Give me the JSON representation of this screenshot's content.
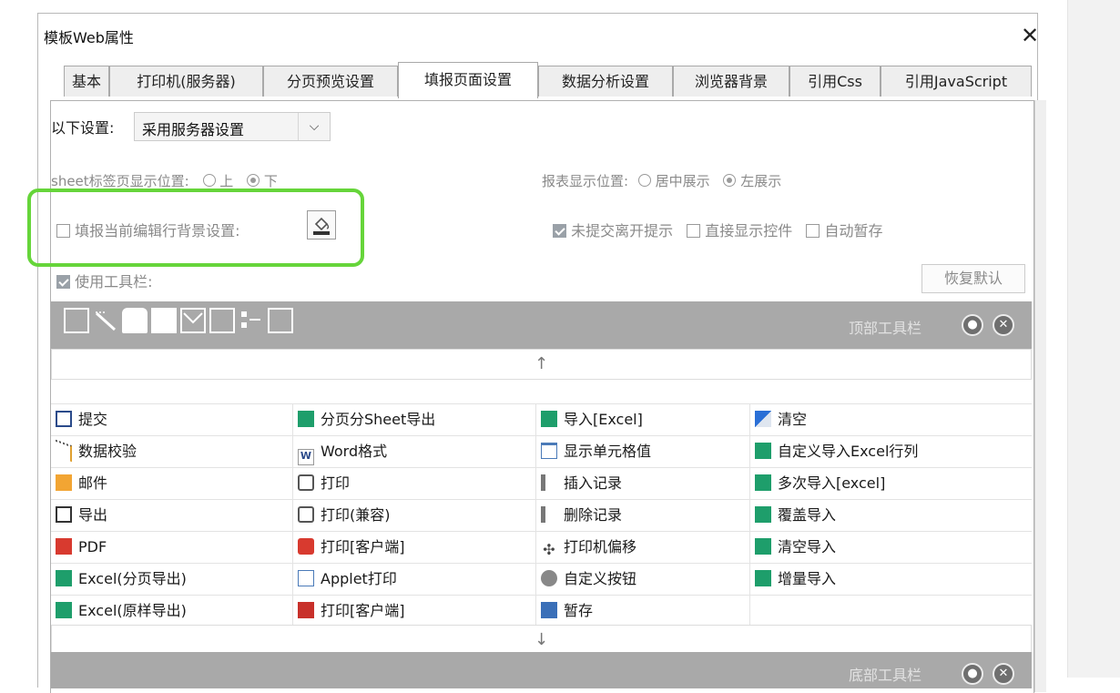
{
  "dialog": {
    "title": "模板Web属性",
    "close_label": "✕"
  },
  "tabs": [
    {
      "label": "基本"
    },
    {
      "label": "打印机(服务器)"
    },
    {
      "label": "分页预览设置"
    },
    {
      "label": "填报页面设置"
    },
    {
      "label": "数据分析设置"
    },
    {
      "label": "浏览器背景"
    },
    {
      "label": "引用Css"
    },
    {
      "label": "引用JavaScript"
    }
  ],
  "active_tab": "填报页面设置",
  "settings": {
    "source_label": "以下设置:",
    "source_value": "采用服务器设置",
    "sheet_tab_label": "sheet标签页显示位置:",
    "sheet_tab_options": [
      "上",
      "下"
    ],
    "sheet_tab_selected": "下",
    "report_pos_label": "报表显示位置:",
    "report_pos_options": [
      "居中展示",
      "左展示"
    ],
    "report_pos_selected": "左展示",
    "edit_row_bg_label": "填报当前编辑行背景设置:",
    "unsubmitted_label": "未提交离开提示",
    "show_widget_label": "直接显示控件",
    "autosave_label": "自动暂存",
    "use_toolbar_label": "使用工具栏:",
    "reset_label": "恢复默认",
    "top_toolbar_label": "顶部工具栏",
    "bottom_toolbar_label": "底部工具栏"
  },
  "arrows": {
    "up": "↑",
    "down": "↓"
  },
  "button_grid": [
    [
      {
        "label": "提交",
        "icon": "save-icon"
      },
      {
        "label": "数据校验",
        "icon": "verify-icon"
      },
      {
        "label": "邮件",
        "icon": "mail-icon"
      },
      {
        "label": "导出",
        "icon": "export-icon"
      },
      {
        "label": "PDF",
        "icon": "pdf-icon"
      },
      {
        "label": "Excel(分页导出)",
        "icon": "excel-icon"
      },
      {
        "label": "Excel(原样导出)",
        "icon": "excel-icon"
      }
    ],
    [
      {
        "label": "分页分Sheet导出",
        "icon": "excel-icon"
      },
      {
        "label": "Word格式",
        "icon": "word-icon"
      },
      {
        "label": "打印",
        "icon": "print-icon"
      },
      {
        "label": "打印(兼容)",
        "icon": "print-icon"
      },
      {
        "label": "打印[客户端]",
        "icon": "flash-print-icon"
      },
      {
        "label": "Applet打印",
        "icon": "applet-icon"
      },
      {
        "label": "打印[客户端]",
        "icon": "pdf-print-icon"
      }
    ],
    [
      {
        "label": "导入[Excel]",
        "icon": "excel-icon"
      },
      {
        "label": "显示单元格值",
        "icon": "cell-icon"
      },
      {
        "label": "插入记录",
        "icon": "insert-row-icon"
      },
      {
        "label": "删除记录",
        "icon": "delete-row-icon"
      },
      {
        "label": "打印机偏移",
        "icon": "move-icon"
      },
      {
        "label": "自定义按钮",
        "icon": "gear-icon"
      },
      {
        "label": "暂存",
        "icon": "stash-icon"
      }
    ],
    [
      {
        "label": "清空",
        "icon": "eraser-icon"
      },
      {
        "label": "自定义导入Excel行列",
        "icon": "excel-icon"
      },
      {
        "label": "多次导入[excel]",
        "icon": "excel-icon"
      },
      {
        "label": "覆盖导入",
        "icon": "excel-icon"
      },
      {
        "label": "清空导入",
        "icon": "excel-icon"
      },
      {
        "label": "增量导入",
        "icon": "excel-icon"
      },
      {
        "label": "",
        "icon": ""
      }
    ]
  ],
  "colors": {
    "highlight": "#66d53a",
    "toolbar_bg": "#a9a9a9",
    "excel_green": "#1e9e6b"
  }
}
